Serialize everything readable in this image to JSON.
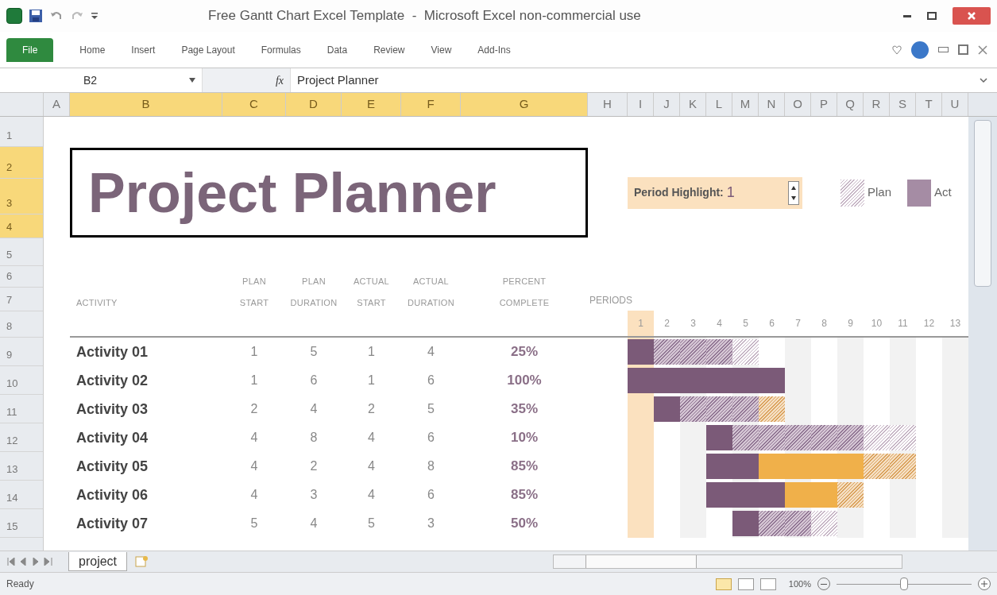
{
  "window": {
    "title": "Free Gantt Chart Excel Template  -  Microsoft Excel non-commercial use"
  },
  "ribbon_tabs": [
    {
      "label": "File",
      "selected": true
    },
    {
      "label": "Home",
      "selected": false
    },
    {
      "label": "Insert",
      "selected": false
    },
    {
      "label": "Page Layout",
      "selected": false
    },
    {
      "label": "Formulas",
      "selected": false
    },
    {
      "label": "Data",
      "selected": false
    },
    {
      "label": "Review",
      "selected": false
    },
    {
      "label": "View",
      "selected": false
    },
    {
      "label": "Add-Ins",
      "selected": false
    }
  ],
  "formula_bar": {
    "name_box": "B2",
    "fx": "fx",
    "value": "Project Planner"
  },
  "column_headers": [
    {
      "label": "A",
      "selected": false
    },
    {
      "label": "B",
      "selected": true
    },
    {
      "label": "C",
      "selected": true
    },
    {
      "label": "D",
      "selected": true
    },
    {
      "label": "E",
      "selected": true
    },
    {
      "label": "F",
      "selected": true
    },
    {
      "label": "G",
      "selected": true
    },
    {
      "label": "H",
      "selected": false
    },
    {
      "label": "I",
      "selected": false
    },
    {
      "label": "J",
      "selected": false
    },
    {
      "label": "K",
      "selected": false
    },
    {
      "label": "L",
      "selected": false
    },
    {
      "label": "M",
      "selected": false
    },
    {
      "label": "N",
      "selected": false
    },
    {
      "label": "O",
      "selected": false
    },
    {
      "label": "P",
      "selected": false
    },
    {
      "label": "Q",
      "selected": false
    },
    {
      "label": "R",
      "selected": false
    },
    {
      "label": "S",
      "selected": false
    },
    {
      "label": "T",
      "selected": false
    },
    {
      "label": "U",
      "selected": false
    }
  ],
  "row_numbers": [
    {
      "label": "1",
      "selected": false
    },
    {
      "label": "2",
      "selected": true
    },
    {
      "label": "3",
      "selected": true
    },
    {
      "label": "4",
      "selected": true
    },
    {
      "label": "5",
      "selected": false
    },
    {
      "label": "6",
      "selected": false
    },
    {
      "label": "7",
      "selected": false
    },
    {
      "label": "8",
      "selected": false
    },
    {
      "label": "9",
      "selected": false
    },
    {
      "label": "10",
      "selected": false
    },
    {
      "label": "11",
      "selected": false
    },
    {
      "label": "12",
      "selected": false
    },
    {
      "label": "13",
      "selected": false
    },
    {
      "label": "14",
      "selected": false
    },
    {
      "label": "15",
      "selected": false
    }
  ],
  "sheet_title": "Project Planner",
  "period_highlight": {
    "label": "Period Highlight:",
    "value": "1"
  },
  "legend": [
    {
      "kind": "plan",
      "label": "Plan"
    },
    {
      "kind": "actual",
      "label": "Act"
    }
  ],
  "table": {
    "columns": [
      "ACTIVITY",
      "PLAN\nSTART",
      "PLAN\nDURATION",
      "ACTUAL\nSTART",
      "ACTUAL\nDURATION",
      "PERCENT\nCOMPLETE"
    ],
    "periods_label": "PERIODS",
    "periods": [
      "1",
      "2",
      "3",
      "4",
      "5",
      "6",
      "7",
      "8",
      "9",
      "10",
      "11",
      "12",
      "13"
    ],
    "rows": [
      {
        "activity": "Activity 01",
        "plan_start": "1",
        "plan_duration": "5",
        "actual_start": "1",
        "actual_duration": "4",
        "percent": "25%"
      },
      {
        "activity": "Activity 02",
        "plan_start": "1",
        "plan_duration": "6",
        "actual_start": "1",
        "actual_duration": "6",
        "percent": "100%"
      },
      {
        "activity": "Activity 03",
        "plan_start": "2",
        "plan_duration": "4",
        "actual_start": "2",
        "actual_duration": "5",
        "percent": "35%"
      },
      {
        "activity": "Activity 04",
        "plan_start": "4",
        "plan_duration": "8",
        "actual_start": "4",
        "actual_duration": "6",
        "percent": "10%"
      },
      {
        "activity": "Activity 05",
        "plan_start": "4",
        "plan_duration": "2",
        "actual_start": "4",
        "actual_duration": "8",
        "percent": "85%"
      },
      {
        "activity": "Activity 06",
        "plan_start": "4",
        "plan_duration": "3",
        "actual_start": "4",
        "actual_duration": "6",
        "percent": "85%"
      },
      {
        "activity": "Activity 07",
        "plan_start": "5",
        "plan_duration": "4",
        "actual_start": "5",
        "actual_duration": "3",
        "percent": "50%"
      }
    ]
  },
  "sheet_tabs": [
    {
      "label": "project",
      "selected": true
    }
  ],
  "status_bar": {
    "status": "Ready",
    "zoom": "100%",
    "level": 0.5
  }
}
